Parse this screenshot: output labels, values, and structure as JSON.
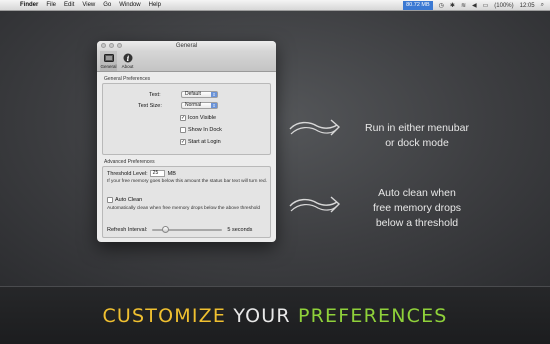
{
  "menubar": {
    "apple_icon": "apple-icon",
    "items": [
      "Finder",
      "File",
      "Edit",
      "View",
      "Go",
      "Window",
      "Help"
    ],
    "memory_badge": "80.72 MB",
    "battery": "(100%)",
    "clock": "12:05"
  },
  "window": {
    "title": "General",
    "toolbar": [
      {
        "label": "General",
        "icon": "general-icon"
      },
      {
        "label": "About",
        "icon": "info-icon"
      }
    ],
    "general": {
      "section_label": "General Preferences",
      "text_label": "Text:",
      "text_value": "Default",
      "text_size_label": "Text Size:",
      "text_size_value": "Normal",
      "icon_visible_label": "Icon Visible",
      "icon_visible_checked": true,
      "show_in_dock_label": "Show In Dock",
      "show_in_dock_checked": false,
      "start_at_login_label": "Start at Login",
      "start_at_login_checked": true
    },
    "advanced": {
      "section_label": "Advanced Preferences",
      "threshold_label": "Threshold Level:",
      "threshold_value": "25",
      "threshold_unit": "MB",
      "threshold_note": "If your free memory goes below this amount the status bar text will turn red.",
      "auto_clean_label": "Auto Clean",
      "auto_clean_checked": false,
      "auto_clean_note": "Automatically clean when free memory drops below the above threshold",
      "refresh_label": "Refresh Interval:",
      "refresh_value": "5 seconds",
      "refresh_slider_fraction": 0.15
    }
  },
  "annotations": {
    "first": [
      "Run in either menubar",
      "or dock mode"
    ],
    "second": [
      "Auto clean when",
      "free memory drops",
      "below a threshold"
    ]
  },
  "footer": {
    "word1": "CUSTOMIZE",
    "word2": "YOUR",
    "word3": "PREFERENCES",
    "colors": {
      "word1": "#f0c030",
      "word2": "#e8e8e8",
      "word3": "#8fd13a"
    }
  }
}
